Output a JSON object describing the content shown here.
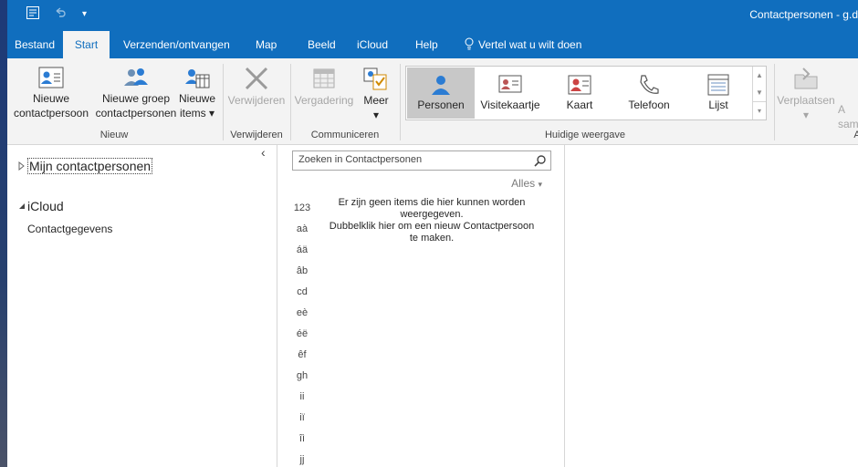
{
  "window": {
    "title": "Contactpersonen - g.d"
  },
  "tabs": [
    {
      "label": "Bestand"
    },
    {
      "label": "Start"
    },
    {
      "label": "Verzenden/ontvangen"
    },
    {
      "label": "Map"
    },
    {
      "label": "Beeld"
    },
    {
      "label": "iCloud"
    },
    {
      "label": "Help"
    }
  ],
  "tellme": "Vertel wat u wilt doen",
  "ribbon": {
    "new_contact": {
      "line1": "Nieuwe",
      "line2": "contactpersoon"
    },
    "new_group": {
      "line1": "Nieuwe groep",
      "line2": "contactpersonen"
    },
    "new_items": {
      "line1": "Nieuwe",
      "line2": "items ▾"
    },
    "group_new": "Nieuw",
    "delete": "Verwijderen",
    "group_delete": "Verwijderen",
    "meeting": "Vergadering",
    "more": {
      "line1": "Meer",
      "line2": "▾"
    },
    "group_communicate": "Communiceren",
    "views": [
      {
        "label": "Personen"
      },
      {
        "label": "Visitekaartje"
      },
      {
        "label": "Kaart"
      },
      {
        "label": "Telefoon"
      },
      {
        "label": "Lijst"
      }
    ],
    "group_view": "Huidige weergave",
    "move": "Verplaatsen",
    "move_arrow": "▾",
    "cut_a": "A",
    "cut_sam": "sam",
    "cut_a2": "A"
  },
  "folders": {
    "collapse": "‹",
    "my_contacts": "Mijn contactpersonen",
    "icloud": "iCloud",
    "contactgegevens": "Contactgegevens"
  },
  "search": {
    "placeholder": "Zoeken in Contactpersonen"
  },
  "filter": "Alles",
  "letters": [
    "123",
    "aà",
    "áä",
    "âb",
    "cd",
    "eè",
    "éë",
    "êf",
    "gh",
    "ii",
    "iï",
    "îì",
    "jj"
  ],
  "empty_message": [
    "Er zijn geen items die hier kunnen worden",
    "weergegeven.",
    "Dubbelklik hier om een nieuw Contactpersoon",
    "te maken."
  ]
}
